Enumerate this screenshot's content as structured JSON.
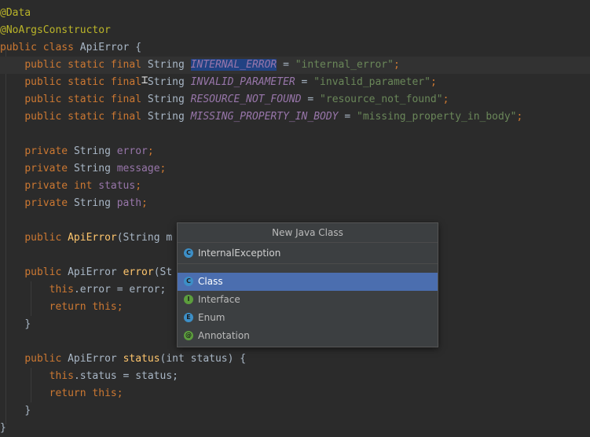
{
  "code": {
    "ann_data": "@Data",
    "ann_noargs": "@NoArgsConstructor",
    "kw_public": "public",
    "kw_class": "class",
    "kw_static": "static",
    "kw_final": "final",
    "kw_private": "private",
    "kw_int": "int",
    "kw_this": "this",
    "kw_return": "return",
    "class_name": "ApiError",
    "type_string": "String",
    "brace_open": " {",
    "brace_close": "}",
    "eq": " = ",
    "semi": ";",
    "const1_name": "INTERNAL_ERROR",
    "const1_val": "\"internal_error\"",
    "const2_name": "INVALID_PARAMETER",
    "const2_val": "\"invalid_parameter\"",
    "const3_name": "RESOURCE_NOT_FOUND",
    "const3_val": "\"resource_not_found\"",
    "const4_name": "MISSING_PROPERTY_IN_BODY",
    "const4_val": "\"missing_property_in_body\"",
    "field_error": "error",
    "field_message": "message",
    "field_status": "status",
    "field_path": "path",
    "ctor_sig": "(String m",
    "method_error": "error",
    "method_error_sig": "(St",
    "this_error_rest": ".error = error;",
    "return_this": " this;",
    "method_status": "status",
    "method_status_sig": "(int status) {",
    "this_status_rest": ".status = status;"
  },
  "popup": {
    "title": "New Java Class",
    "input_value": "InternalException",
    "items": [
      {
        "label": "Class",
        "icon": "C",
        "color": "#3d8fc7"
      },
      {
        "label": "Interface",
        "icon": "I",
        "color": "#5c9e3d"
      },
      {
        "label": "Enum",
        "icon": "E",
        "color": "#3d8fc7"
      },
      {
        "label": "Annotation",
        "icon": "@",
        "color": "#5c9e3d"
      }
    ]
  }
}
